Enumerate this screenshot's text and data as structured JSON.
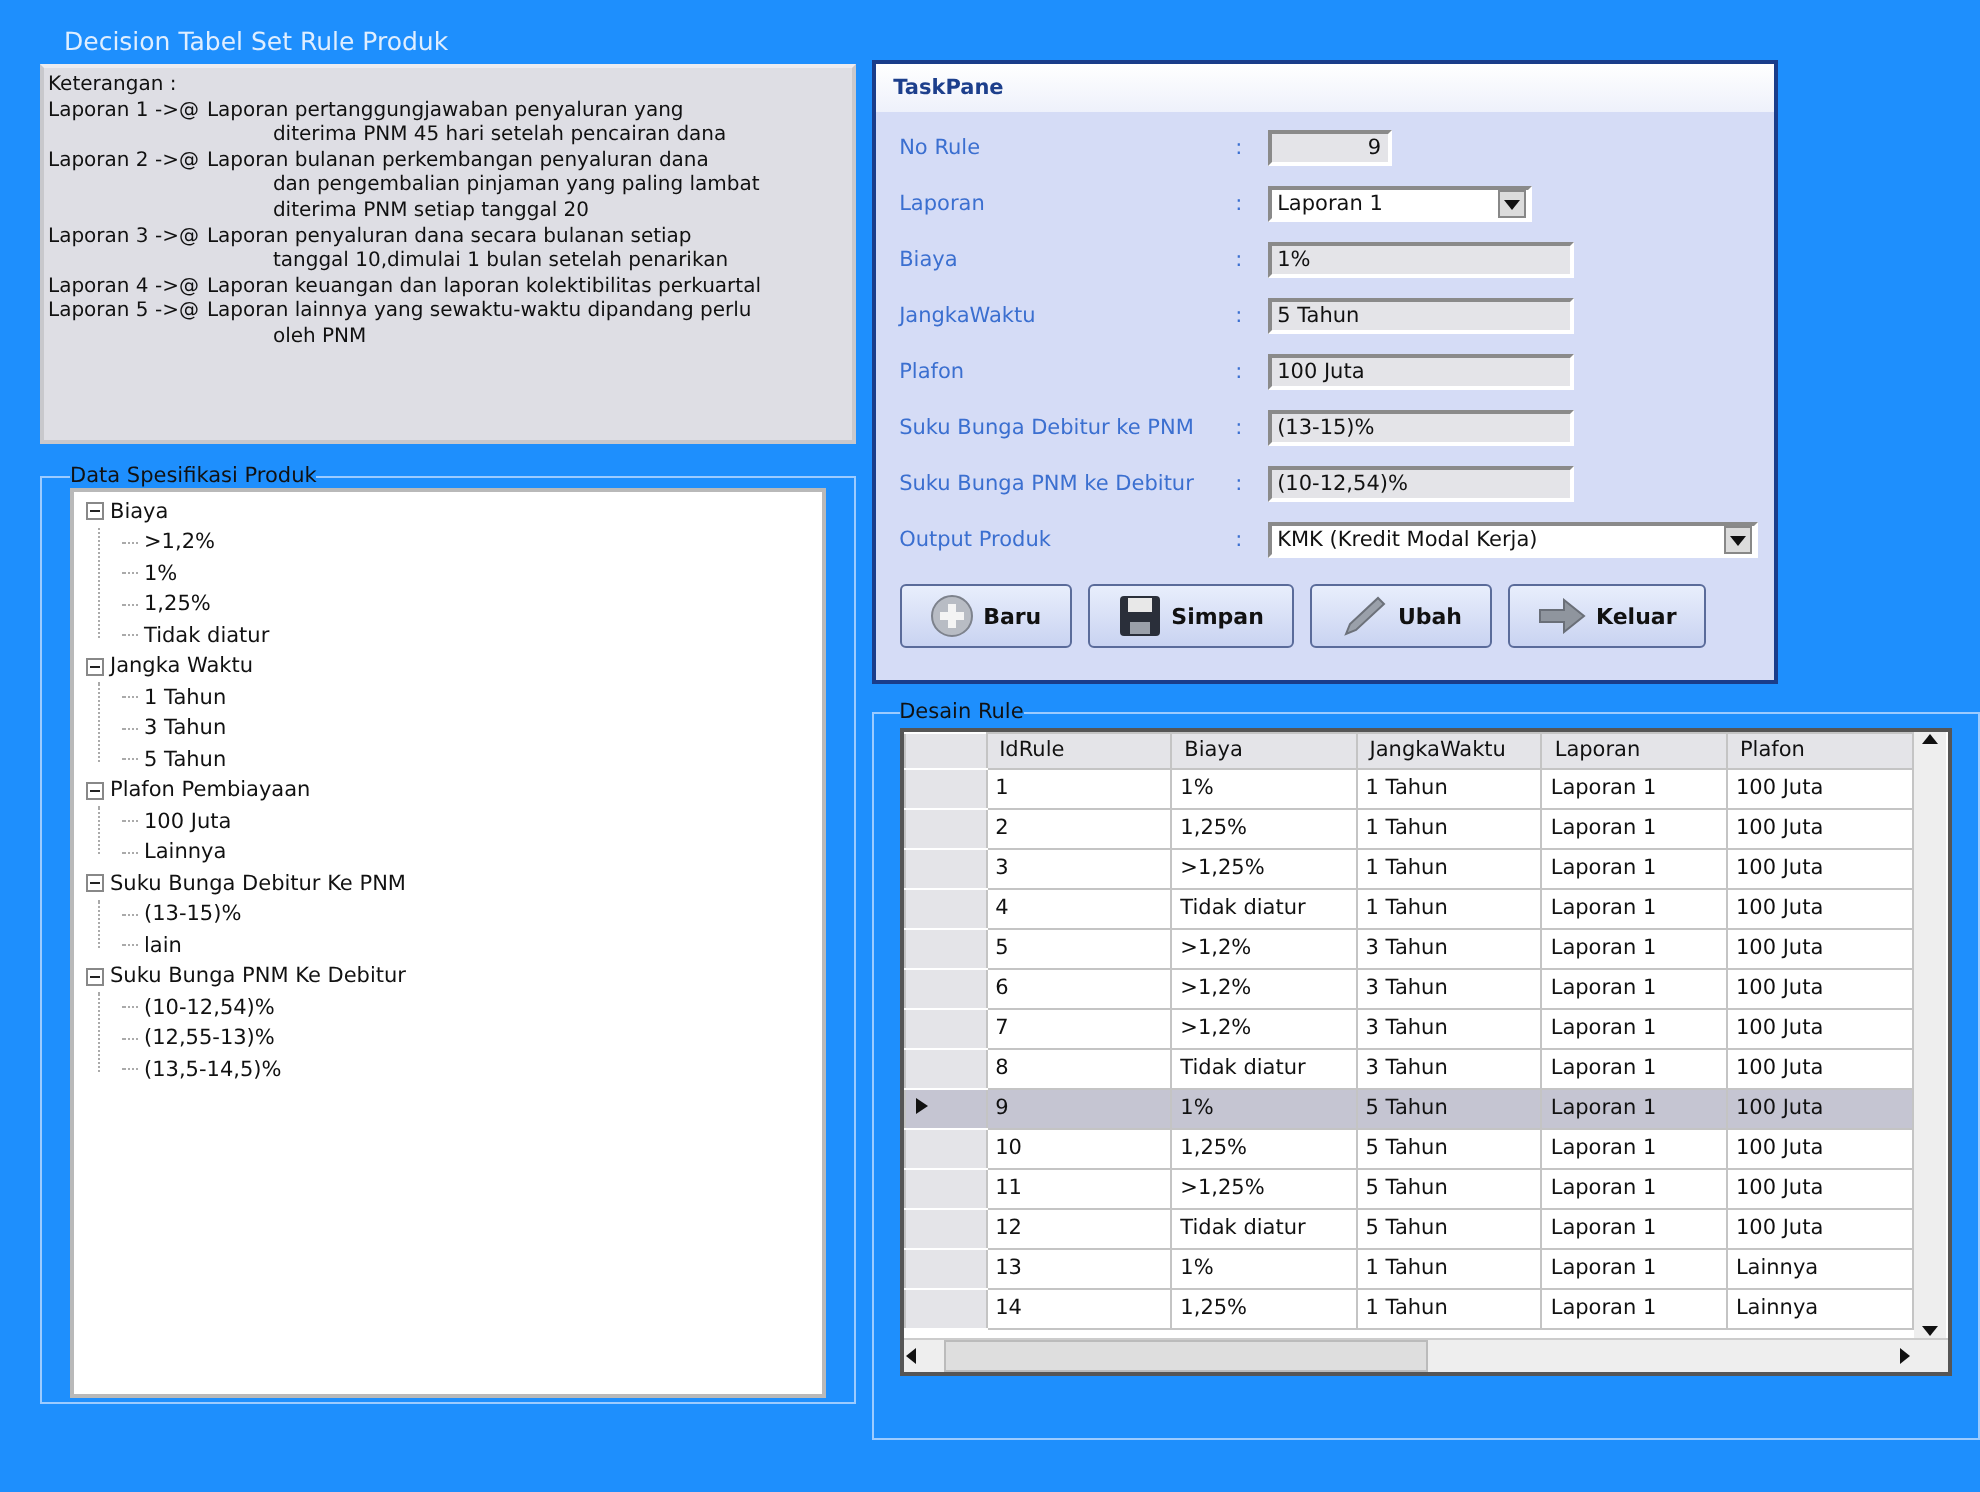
{
  "window": {
    "title": "Decision Tabel Set Rule Produk"
  },
  "keterangan": {
    "heading": "Keterangan :",
    "items": [
      {
        "prefix": "Laporan 1 ->@",
        "lines": [
          "Laporan pertanggungjawaban penyaluran yang",
          "diterima PNM 45 hari setelah pencairan dana"
        ]
      },
      {
        "prefix": "Laporan 2 ->@",
        "lines": [
          "Laporan bulanan perkembangan penyaluran dana",
          "dan pengembalian pinjaman yang paling lambat",
          "diterima PNM setiap tanggal 20"
        ]
      },
      {
        "prefix": "Laporan 3 ->@",
        "lines": [
          "Laporan penyaluran dana secara bulanan setiap",
          "tanggal 10,dimulai 1 bulan setelah penarikan"
        ]
      },
      {
        "prefix": "Laporan 4 ->@",
        "lines": [
          "Laporan keuangan dan laporan kolektibilitas perkuartal"
        ]
      },
      {
        "prefix": "Laporan 5 ->@",
        "lines": [
          "Laporan lainnya yang sewaktu-waktu dipandang perlu",
          "oleh PNM"
        ]
      }
    ]
  },
  "spesifikasi": {
    "title": "Data Spesifikasi Produk",
    "tree": [
      {
        "label": "Biaya",
        "expanded": true,
        "children": [
          {
            "label": ">1,2%"
          },
          {
            "label": "1%"
          },
          {
            "label": "1,25%"
          },
          {
            "label": "Tidak diatur"
          }
        ]
      },
      {
        "label": "Jangka Waktu",
        "expanded": true,
        "children": [
          {
            "label": "1 Tahun"
          },
          {
            "label": "3 Tahun"
          },
          {
            "label": "5 Tahun"
          }
        ]
      },
      {
        "label": "Plafon Pembiayaan",
        "expanded": true,
        "children": [
          {
            "label": "100 Juta"
          },
          {
            "label": "Lainnya"
          }
        ]
      },
      {
        "label": "Suku Bunga Debitur Ke PNM",
        "expanded": true,
        "children": [
          {
            "label": "(13-15)%"
          },
          {
            "label": "lain"
          }
        ]
      },
      {
        "label": "Suku Bunga PNM Ke Debitur",
        "expanded": true,
        "children": [
          {
            "label": "(10-12,54)%"
          },
          {
            "label": "(12,55-13)%"
          },
          {
            "label": "(13,5-14,5)%"
          }
        ]
      }
    ]
  },
  "taskpane": {
    "title": "TaskPane",
    "fields": [
      {
        "label": "No Rule",
        "kind": "number",
        "value": "9"
      },
      {
        "label": "Laporan",
        "kind": "select",
        "value": "Laporan 1"
      },
      {
        "label": "Biaya",
        "kind": "text",
        "value": "1%"
      },
      {
        "label": "JangkaWaktu",
        "kind": "text",
        "value": "5 Tahun"
      },
      {
        "label": "Plafon",
        "kind": "text",
        "value": "100 Juta"
      },
      {
        "label": "Suku Bunga Debitur ke PNM",
        "kind": "text",
        "value": "(13-15)%"
      },
      {
        "label": "Suku Bunga PNM ke Debitur",
        "kind": "text",
        "value": "(10-12,54)%"
      },
      {
        "label": "Output Produk",
        "kind": "wideselect",
        "value": "KMK (Kredit Modal Kerja)"
      }
    ],
    "separator": ":",
    "buttons": [
      {
        "label": "Baru",
        "kind": "add"
      },
      {
        "label": "Simpan",
        "kind": "save"
      },
      {
        "label": "Ubah",
        "kind": "edit"
      },
      {
        "label": "Keluar",
        "kind": "exit"
      }
    ]
  },
  "desain": {
    "title": "Desain Rule",
    "columns": [
      "IdRule",
      "Biaya",
      "JangkaWaktu",
      "Laporan",
      "Plafon"
    ],
    "rows": [
      {
        "cells": [
          "1",
          "1%",
          "1 Tahun",
          "Laporan 1",
          "100 Juta"
        ],
        "selected": false
      },
      {
        "cells": [
          "2",
          "1,25%",
          "1 Tahun",
          "Laporan 1",
          "100 Juta"
        ],
        "selected": false
      },
      {
        "cells": [
          "3",
          ">1,25%",
          "1 Tahun",
          "Laporan 1",
          "100 Juta"
        ],
        "selected": false
      },
      {
        "cells": [
          "4",
          "Tidak diatur",
          "1 Tahun",
          "Laporan 1",
          "100 Juta"
        ],
        "selected": false
      },
      {
        "cells": [
          "5",
          ">1,2%",
          "3 Tahun",
          "Laporan 1",
          "100 Juta"
        ],
        "selected": false
      },
      {
        "cells": [
          "6",
          ">1,2%",
          "3 Tahun",
          "Laporan 1",
          "100 Juta"
        ],
        "selected": false
      },
      {
        "cells": [
          "7",
          ">1,2%",
          "3 Tahun",
          "Laporan 1",
          "100 Juta"
        ],
        "selected": false
      },
      {
        "cells": [
          "8",
          "Tidak diatur",
          "3 Tahun",
          "Laporan 1",
          "100 Juta"
        ],
        "selected": false
      },
      {
        "cells": [
          "9",
          "1%",
          "5 Tahun",
          "Laporan 1",
          "100 Juta"
        ],
        "selected": true
      },
      {
        "cells": [
          "10",
          "1,25%",
          "5 Tahun",
          "Laporan 1",
          "100 Juta"
        ],
        "selected": false
      },
      {
        "cells": [
          "11",
          ">1,25%",
          "5 Tahun",
          "Laporan 1",
          "100 Juta"
        ],
        "selected": false
      },
      {
        "cells": [
          "12",
          "Tidak diatur",
          "5 Tahun",
          "Laporan 1",
          "100 Juta"
        ],
        "selected": false
      },
      {
        "cells": [
          "13",
          "1%",
          "1 Tahun",
          "Laporan 1",
          "Lainnya"
        ],
        "selected": false
      },
      {
        "cells": [
          "14",
          "1,25%",
          "1 Tahun",
          "Laporan 1",
          "Lainnya"
        ],
        "selected": false
      }
    ]
  }
}
